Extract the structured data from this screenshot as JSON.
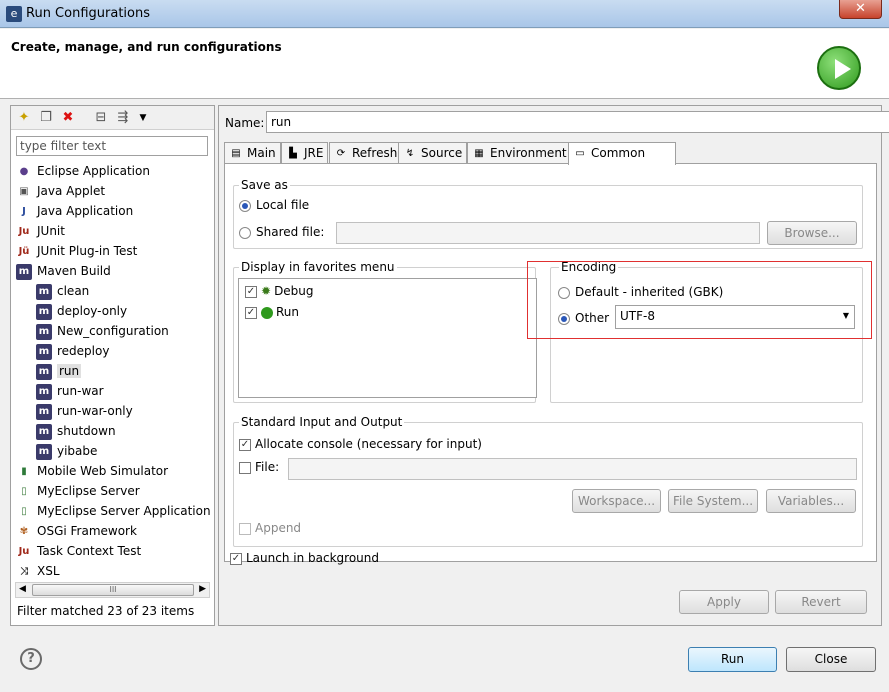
{
  "window": {
    "title": "Run Configurations",
    "close": "✕"
  },
  "header": {
    "title": "Create, manage, and run configurations"
  },
  "left": {
    "filter_placeholder": "type filter text",
    "tree": [
      {
        "label": "Eclipse Application",
        "icon": "eclipse-icon",
        "level": 0
      },
      {
        "label": "Java Applet",
        "icon": "applet-icon",
        "level": 0
      },
      {
        "label": "Java Application",
        "icon": "java-app-icon",
        "level": 0
      },
      {
        "label": "JUnit",
        "icon": "junit-icon",
        "level": 0
      },
      {
        "label": "JUnit Plug-in Test",
        "icon": "junit-plugin-icon",
        "level": 0
      },
      {
        "label": "Maven Build",
        "icon": "maven-icon",
        "level": 0
      },
      {
        "label": "clean",
        "icon": "maven-icon",
        "level": 1
      },
      {
        "label": "deploy-only",
        "icon": "maven-icon",
        "level": 1
      },
      {
        "label": "New_configuration",
        "icon": "maven-icon",
        "level": 1
      },
      {
        "label": "redeploy",
        "icon": "maven-icon",
        "level": 1
      },
      {
        "label": "run",
        "icon": "maven-icon",
        "level": 1,
        "selected": true
      },
      {
        "label": "run-war",
        "icon": "maven-icon",
        "level": 1
      },
      {
        "label": "run-war-only",
        "icon": "maven-icon",
        "level": 1
      },
      {
        "label": "shutdown",
        "icon": "maven-icon",
        "level": 1
      },
      {
        "label": "yibabe",
        "icon": "maven-icon",
        "level": 1
      },
      {
        "label": "Mobile Web Simulator",
        "icon": "mobile-icon",
        "level": 0
      },
      {
        "label": "MyEclipse Server",
        "icon": "server-icon",
        "level": 0
      },
      {
        "label": "MyEclipse Server Application",
        "icon": "server-app-icon",
        "level": 0
      },
      {
        "label": "OSGi Framework",
        "icon": "osgi-icon",
        "level": 0
      },
      {
        "label": "Task Context Test",
        "icon": "task-icon",
        "level": 0
      },
      {
        "label": "XSL",
        "icon": "xsl-icon",
        "level": 0
      }
    ],
    "scroll_thumb": "III",
    "status": "Filter matched 23 of 23 items"
  },
  "right": {
    "name_label": "Name:",
    "name_value": "run",
    "tabs": [
      {
        "label": "Main",
        "icon": "main-tab-icon"
      },
      {
        "label": "JRE",
        "icon": "jre-icon"
      },
      {
        "label": "Refresh",
        "icon": "refresh-icon"
      },
      {
        "label": "Source",
        "icon": "source-icon"
      },
      {
        "label": "Environment",
        "icon": "environment-icon"
      },
      {
        "label": "Common",
        "icon": "common-icon",
        "active": true
      }
    ],
    "save_as": {
      "title": "Save as",
      "local": "Local file",
      "shared": "Shared file:",
      "browse": "Browse..."
    },
    "favorites": {
      "title": "Display in favorites menu",
      "items": [
        "Debug",
        "Run"
      ]
    },
    "encoding": {
      "title": "Encoding",
      "default": "Default - inherited (GBK)",
      "other": "Other",
      "value": "UTF-8"
    },
    "stdio": {
      "title": "Standard Input and Output",
      "allocate": "Allocate console (necessary for input)",
      "file": "File:",
      "workspace": "Workspace...",
      "filesystem": "File System...",
      "variables": "Variables...",
      "append": "Append"
    },
    "launch_bg": "Launch in background",
    "apply": "Apply",
    "revert": "Revert"
  },
  "footer": {
    "run": "Run",
    "close": "Close",
    "help": "?"
  }
}
